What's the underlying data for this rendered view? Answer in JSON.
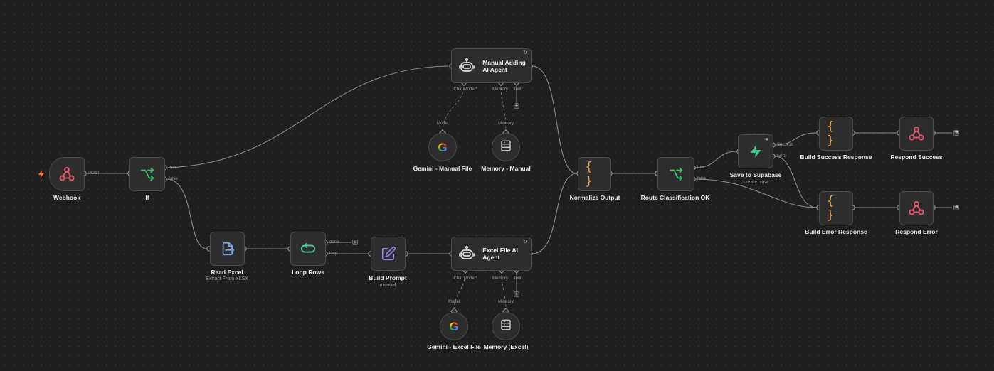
{
  "colors": {
    "background": "#1f1f1f",
    "node": "#2d2d2d",
    "connection": "#8a8a8a",
    "webhook": "#e05a6a",
    "switch": "#3fbf6a",
    "code": "#f0a040",
    "file": "#7aa7e8",
    "loop": "#4fc4a0",
    "edit": "#9a80f0",
    "supabase": "#3ecf8e",
    "trigger_bolt": "#ff6d3a"
  },
  "nodes": {
    "webhook": {
      "title": "Webhook",
      "icon": "webhook-icon"
    },
    "if": {
      "title": "If",
      "icon": "branch-icon"
    },
    "read_excel": {
      "title": "Read Excel",
      "subtitle": "Extract From XLSX",
      "icon": "file-export-icon"
    },
    "loop_rows": {
      "title": "Loop Rows",
      "icon": "loop-icon"
    },
    "build_prompt": {
      "title": "Build Prompt",
      "subtitle": "manual",
      "icon": "edit-icon"
    },
    "manual_agent": {
      "title": "Manual Adding AI Agent",
      "icon": "robot-icon"
    },
    "excel_agent": {
      "title": "Excel File AI Agent",
      "icon": "robot-icon"
    },
    "gemini_manual": {
      "title": "Gemini - Manual File",
      "icon": "google-icon"
    },
    "memory_manual": {
      "title": "Memory - Manual",
      "icon": "database-icon"
    },
    "gemini_excel": {
      "title": "Gemini - Excel File",
      "icon": "google-icon"
    },
    "memory_excel": {
      "title": "Memory (Excel)",
      "icon": "database-icon"
    },
    "normalize": {
      "title": "Normalize Output",
      "icon": "braces-icon"
    },
    "route": {
      "title": "Route Classification OK",
      "icon": "branch-icon"
    },
    "supabase": {
      "title": "Save to Supabase",
      "subtitle": "create: row",
      "icon": "supabase-icon"
    },
    "build_success": {
      "title": "Build Success Response",
      "icon": "braces-icon"
    },
    "build_error": {
      "title": "Build Error Response",
      "icon": "braces-icon"
    },
    "respond_success": {
      "title": "Respond Success",
      "icon": "webhook-icon"
    },
    "respond_error": {
      "title": "Respond Error",
      "icon": "webhook-icon"
    }
  },
  "ports": {
    "post": "POST",
    "true": "true",
    "false": "false",
    "done": "done",
    "loop": "loop",
    "chat_model": "Chat Model*",
    "memory": "Memory",
    "tool": "Tool",
    "model": "Model",
    "success": "Success",
    "error": "Error",
    "plus": "+"
  }
}
